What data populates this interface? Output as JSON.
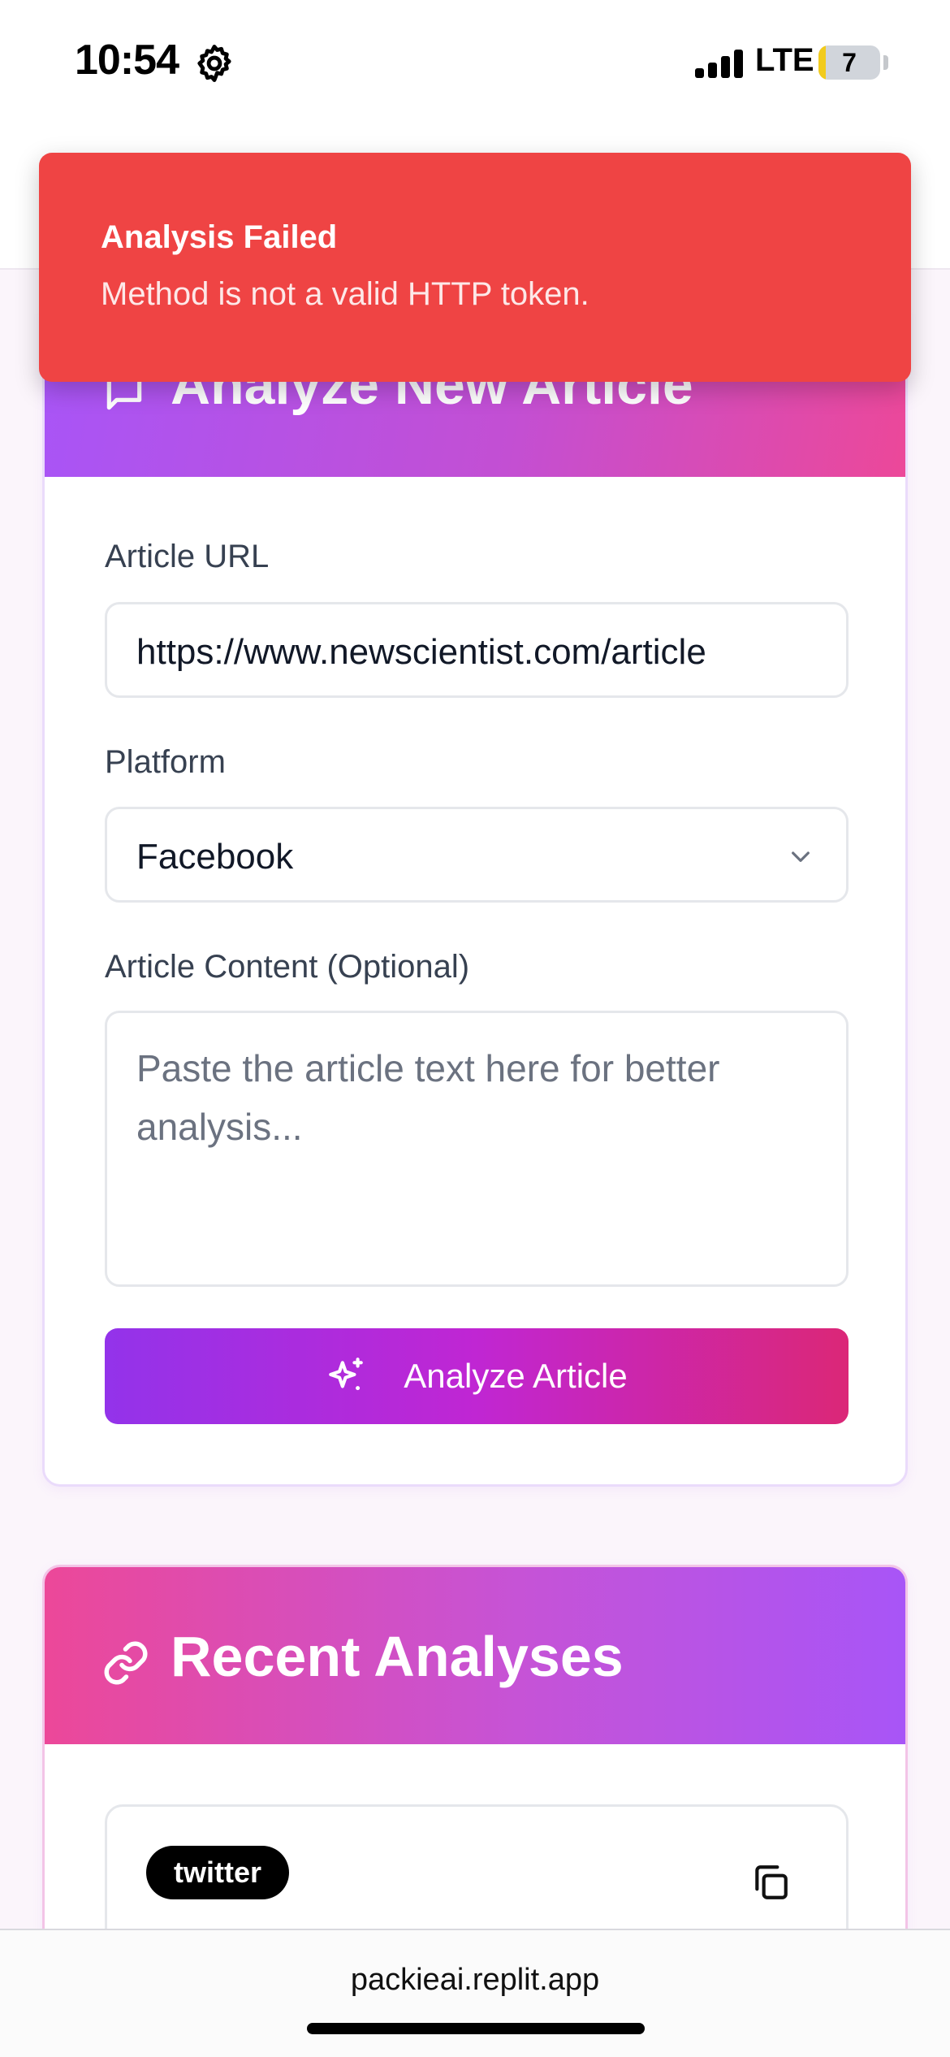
{
  "status_bar": {
    "time": "10:54",
    "network": "LTE",
    "battery": "7",
    "battery_level": 0.07
  },
  "toast": {
    "title": "Analysis Failed",
    "message": "Method is not a valid HTTP token.",
    "color": "#ef4444"
  },
  "analyze_card": {
    "title": "Analyze New Article",
    "url_label": "Article URL",
    "url_value": "https://www.newscientist.com/article",
    "platform_label": "Platform",
    "platform_value": "Facebook",
    "content_label": "Article Content (Optional)",
    "content_placeholder": "Paste the article text here for better analysis...",
    "submit_label": "Analyze Article"
  },
  "recent_card": {
    "title": "Recent Analyses",
    "items": [
      {
        "platform_badge": "twitter"
      }
    ]
  },
  "browser": {
    "domain": "packieai.replit.app"
  },
  "colors": {
    "accent_purple": "#a855f7",
    "accent_pink": "#ec4899",
    "error": "#ef4444"
  }
}
